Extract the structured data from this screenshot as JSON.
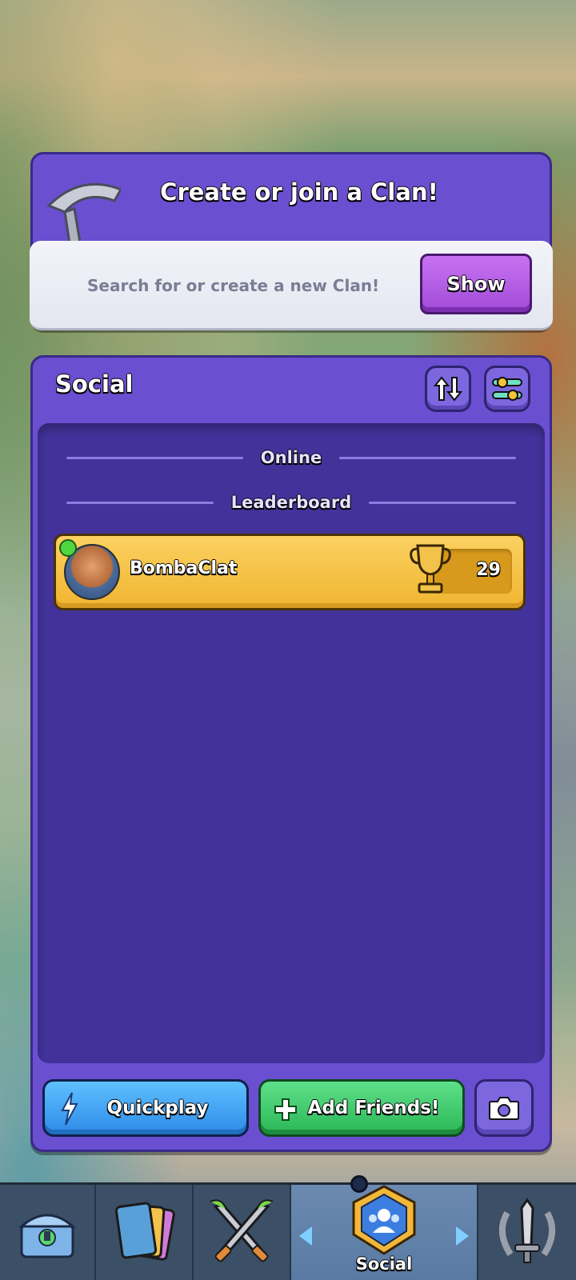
{
  "clan": {
    "title": "Create or join a Clan!",
    "search_hint": "Search for or create a new Clan!",
    "show_label": "Show"
  },
  "social": {
    "title": "Social",
    "sections": {
      "online": "Online",
      "leaderboard": "Leaderboard"
    },
    "friends": [
      {
        "name": "BombaClat",
        "trophies": "29",
        "online": true
      }
    ],
    "quickplay_label": "Quickplay",
    "add_friends_label": "Add Friends!"
  },
  "nav": {
    "items": [
      {
        "icon": "chest-icon"
      },
      {
        "icon": "cards-icon"
      },
      {
        "icon": "battle-swords-icon"
      },
      {
        "icon": "social-icon",
        "label": "Social",
        "active": true
      },
      {
        "icon": "sword-laurel-icon"
      }
    ]
  },
  "colors": {
    "panel_purple": "#6a4fd0",
    "list_purple": "#42329a",
    "friend_gold": "#f0b531",
    "quickplay_blue": "#2d8ae8",
    "add_green": "#29b756",
    "show_purple": "#a14bd8"
  }
}
